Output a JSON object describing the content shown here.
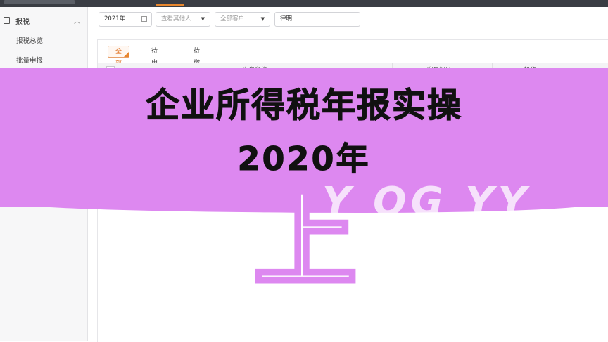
{
  "sidebar": {
    "group": {
      "label": "报税",
      "icon": "document-icon",
      "expand_icon": "chevron-up-icon"
    },
    "items": [
      {
        "label": "报税总览"
      },
      {
        "label": "批量申报"
      }
    ]
  },
  "filters": {
    "year": {
      "value": "2021年",
      "icon": "calendar-icon"
    },
    "others": {
      "placeholder": "查看其他人",
      "icon": "caret-down-icon"
    },
    "customers": {
      "placeholder": "全部客户",
      "icon": "caret-down-icon"
    },
    "search": {
      "value": "律明"
    }
  },
  "tabs": [
    {
      "label": "全部",
      "active": true
    },
    {
      "label": "待申报",
      "active": false
    },
    {
      "label": "待缴款",
      "active": false
    }
  ],
  "table": {
    "columns": [
      "客户名称",
      "客户编号",
      "操作"
    ]
  },
  "overlay": {
    "title_line1": "企业所得税年报实操",
    "title_line2": "2020年",
    "big_char": "上",
    "ghost_text": "Y OG YY"
  },
  "colors": {
    "banner": "#dd88f0",
    "accent": "#e8872e",
    "topbar": "#3a3d44"
  }
}
